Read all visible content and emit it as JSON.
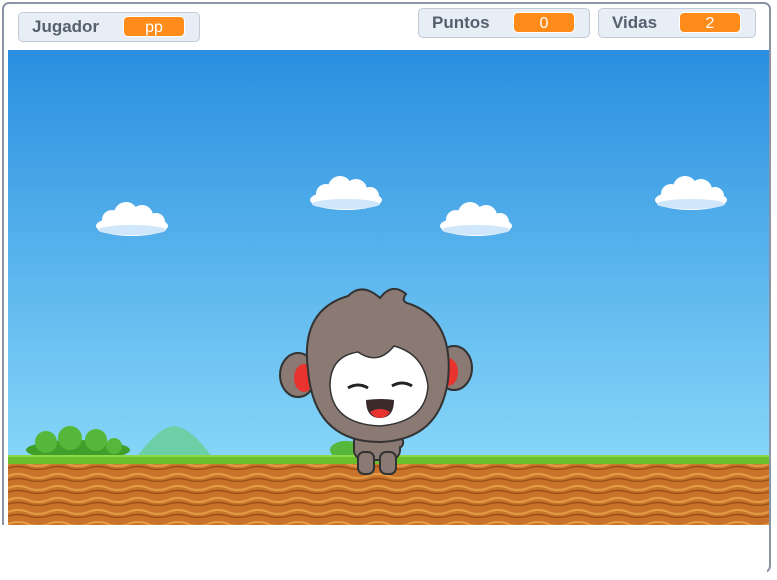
{
  "monitors": {
    "jugador": {
      "label": "Jugador",
      "value": "pp"
    },
    "puntos": {
      "label": "Puntos",
      "value": "0"
    },
    "vidas": {
      "label": "Vidas",
      "value": "2"
    }
  },
  "colors": {
    "sky_top": "#2a8fe0",
    "sky_bottom": "#7fd0f7",
    "monitor_value": "#ff8c1a",
    "monitor_bg": "#e8eef6",
    "grass": "#6bbf2a",
    "dirt": "#c8722a"
  },
  "sprites": {
    "character": "chibi-character-sprite",
    "clouds": "cloud-icon",
    "bush": "bush-icon",
    "hill": "hill-icon"
  }
}
